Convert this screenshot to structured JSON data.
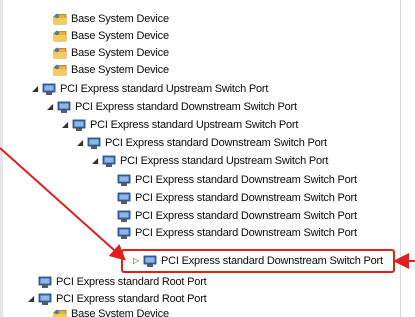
{
  "tree": {
    "items": [
      {
        "label": "Base System Device",
        "icon": "folder-device-icon",
        "expander": ""
      },
      {
        "label": "Base System Device",
        "icon": "folder-device-icon",
        "expander": ""
      },
      {
        "label": "Base System Device",
        "icon": "folder-device-icon",
        "expander": ""
      },
      {
        "label": "Base System Device",
        "icon": "folder-device-icon",
        "expander": ""
      },
      {
        "label": "PCI Express standard Upstream Switch Port",
        "icon": "pci-port-icon",
        "expander": "◢"
      },
      {
        "label": "PCI Express standard Downstream Switch Port",
        "icon": "pci-port-icon",
        "expander": "◢"
      },
      {
        "label": "PCI Express standard Upstream Switch Port",
        "icon": "pci-port-icon",
        "expander": "◢"
      },
      {
        "label": "PCI Express standard Downstream Switch Port",
        "icon": "pci-port-icon",
        "expander": "◢"
      },
      {
        "label": "PCI Express standard Upstream Switch Port",
        "icon": "pci-port-icon",
        "expander": "◢"
      },
      {
        "label": "PCI Express standard Downstream Switch Port",
        "icon": "pci-port-icon",
        "expander": ""
      },
      {
        "label": "PCI Express standard Downstream Switch Port",
        "icon": "pci-port-icon",
        "expander": ""
      },
      {
        "label": "PCI Express standard Downstream Switch Port",
        "icon": "pci-port-icon",
        "expander": ""
      },
      {
        "label": "PCI Express standard Downstream Switch Port",
        "icon": "pci-port-icon",
        "expander": ""
      },
      {
        "label": "PCI Express standard Downstream Switch Port",
        "icon": "pci-port-icon",
        "expander": "▷"
      },
      {
        "label": "PCI Express standard Root Port",
        "icon": "pci-port-icon",
        "expander": ""
      },
      {
        "label": "PCI Express standard Root Port",
        "icon": "pci-port-icon",
        "expander": "◢"
      },
      {
        "label": "Base System Device",
        "icon": "folder-device-icon",
        "expander": ""
      }
    ]
  },
  "annotation": {
    "color": "#e02020",
    "highlighted_item": "PCI Express standard Downstream Switch Port"
  }
}
